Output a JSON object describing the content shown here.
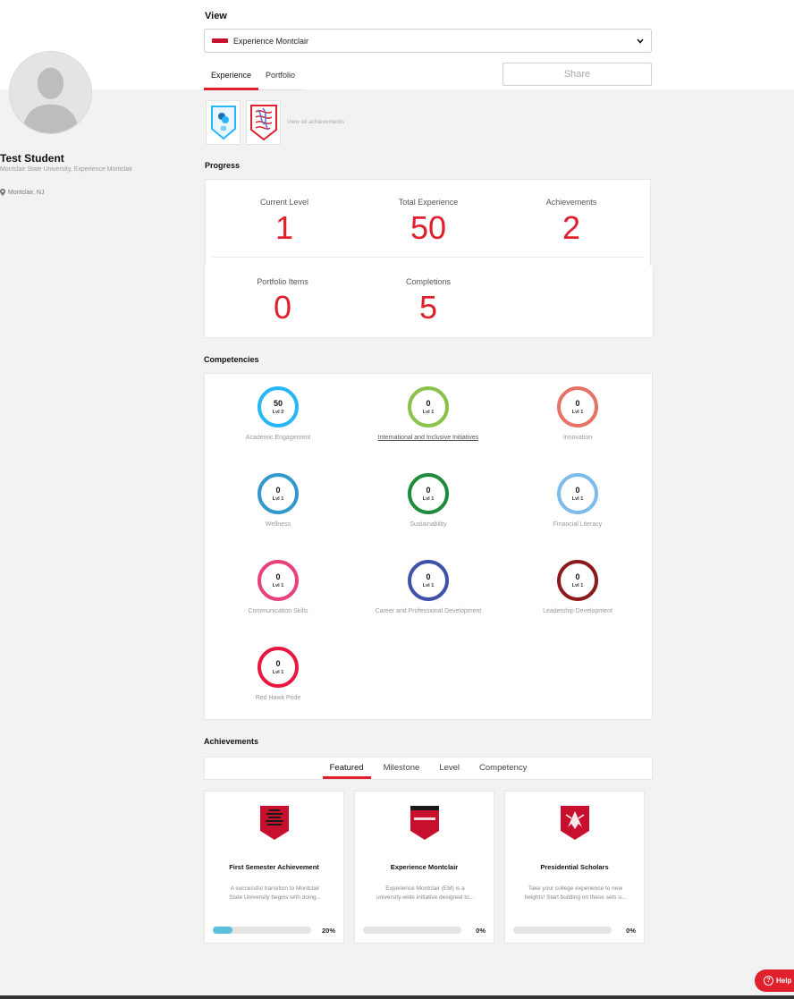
{
  "profile": {
    "name": "Test Student",
    "organization": "Montclair State University, Experience Montclair",
    "location": "Montclair, NJ"
  },
  "view": {
    "label": "View",
    "selected": "Experience Montclair",
    "dropdown_icon": "chevron-down-icon"
  },
  "tabs": [
    {
      "label": "Experience",
      "active": true
    },
    {
      "label": "Portfolio",
      "active": false
    }
  ],
  "share_label": "Share",
  "badges": {
    "view_all": "View all achievements"
  },
  "progress": {
    "title": "Progress",
    "stats": [
      {
        "label": "Current Level",
        "value": "1"
      },
      {
        "label": "Total Experience",
        "value": "50"
      },
      {
        "label": "Achievements",
        "value": "2"
      },
      {
        "label": "Portfolio Items",
        "value": "0"
      },
      {
        "label": "Completions",
        "value": "5"
      }
    ]
  },
  "competencies": {
    "title": "Competencies",
    "items": [
      {
        "name": "Academic Engagement",
        "points": "50",
        "level": "Lvl 2",
        "color": "#29b6f6"
      },
      {
        "name": "International and Inclusive Initiatives",
        "points": "0",
        "level": "Lvl 1",
        "color": "#8bc34a"
      },
      {
        "name": "Innovation",
        "points": "0",
        "level": "Lvl 1",
        "color": "#e57368"
      },
      {
        "name": "Wellness",
        "points": "0",
        "level": "Lvl 1",
        "color": "#3399cc"
      },
      {
        "name": "Sustainability",
        "points": "0",
        "level": "Lvl 1",
        "color": "#1e8c3a"
      },
      {
        "name": "Financial Literacy",
        "points": "0",
        "level": "Lvl 1",
        "color": "#7cbcec"
      },
      {
        "name": "Communication Skills",
        "points": "0",
        "level": "Lvl 1",
        "color": "#e8417e"
      },
      {
        "name": "Career and Professional Development",
        "points": "0",
        "level": "Lvl 1",
        "color": "#3f51a8"
      },
      {
        "name": "Leadership Development",
        "points": "0",
        "level": "Lvl 1",
        "color": "#8b1a1a"
      },
      {
        "name": "Red Hawk Pride",
        "points": "0",
        "level": "Lvl 1",
        "color": "#e8173f"
      }
    ]
  },
  "achievements": {
    "title": "Achievements",
    "tabs": [
      {
        "label": "Featured",
        "active": true
      },
      {
        "label": "Milestone",
        "active": false
      },
      {
        "label": "Level",
        "active": false
      },
      {
        "label": "Competency",
        "active": false
      }
    ],
    "cards": [
      {
        "title": "First Semester Achievement",
        "desc_1": "A successful transition to Montclair",
        "desc_2": "State University begins with doing...",
        "progress": 0.2,
        "pct": "20%"
      },
      {
        "title": "Experience Montclair",
        "desc_1": "Experience Montclair (EM) is a",
        "desc_2": "university-wide initiative designed to...",
        "progress": 0,
        "pct": "0%"
      },
      {
        "title": "Presidential Scholars",
        "desc_1": "Take your college experience to new",
        "desc_2": "heights! Start building on these sets o...",
        "progress": 0,
        "pct": "0%"
      }
    ]
  },
  "help_label": "Help",
  "colors": {
    "accent": "#e0202c",
    "progress_fill": "#5bc0de"
  }
}
